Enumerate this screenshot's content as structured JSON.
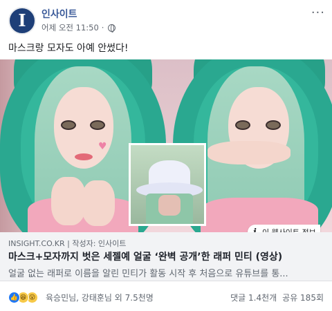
{
  "header": {
    "avatar_letter": "I",
    "page_name": "인사이트",
    "timestamp": "어제 오전 11:50",
    "separator": "·",
    "audience_icon": "globe-icon",
    "more_icon": "more-options-icon",
    "more_glyph": "···"
  },
  "post": {
    "text": "마스크랑 모자도 아예 안썼다!"
  },
  "media": {
    "description_icon": "info-icon",
    "site_info_glyph": "i",
    "site_info_label": "이 웹사이트 정보"
  },
  "link": {
    "domain": "INSIGHT.CO.KR",
    "separator": " | ",
    "author": "작성자: 인사이트",
    "title": "마스크+모자까지 벗은 세젤예 얼굴 ‘완벽 공개’한 래퍼 민티 (영상)",
    "description": "얼굴 없는 래퍼로 이름을 알린 민티가 활동 시작 후 처음으로 유튜브를 통..."
  },
  "reactions": {
    "icons": [
      "like-icon",
      "haha-icon",
      "wow-icon"
    ],
    "like_glyph": "👍",
    "haha_glyph": "😆",
    "wow_glyph": "😮",
    "names": "육승민님, 강태훈님 외 7.5천명",
    "comments": "댓글 1.4천개",
    "shares": "공유 185회"
  },
  "colors": {
    "brand_blue": "#385898",
    "avatar_bg": "#1e3f78",
    "link_box_bg": "#f2f3f5",
    "like_blue": "#2078f4",
    "hood_teal": "#2aa890"
  }
}
